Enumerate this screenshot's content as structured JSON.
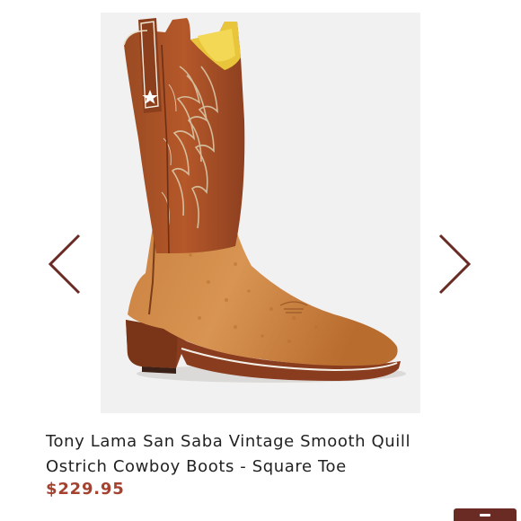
{
  "product": {
    "title": "Tony Lama San Saba Vintage Smooth Quill Ostrich Cowboy Boots - Square Toe",
    "price": "$229.95",
    "image_alt_icon": "cowboy-boot-image"
  },
  "navigation": {
    "prev_icon": "chevron-left-icon",
    "next_icon": "chevron-right-icon"
  },
  "colors": {
    "price": "#a4412f",
    "arrow": "#6b2b25",
    "button": "#6b2b25",
    "title": "#222222"
  }
}
